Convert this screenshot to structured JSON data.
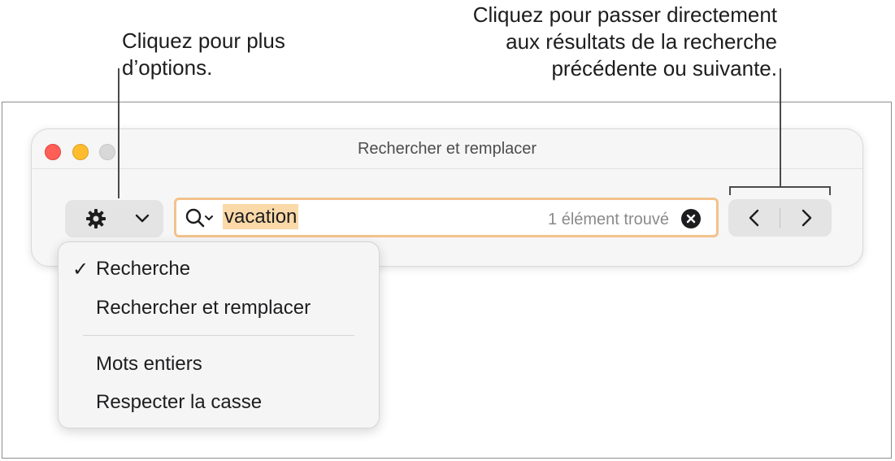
{
  "callouts": {
    "left": [
      "Cliquez pour plus",
      "d’options."
    ],
    "right": [
      "Cliquez pour passer directement",
      "aux résultats de la recherche",
      "précédente ou suivante."
    ]
  },
  "window": {
    "title": "Rechercher et remplacer"
  },
  "toolbar": {
    "options_icon": "gear-icon",
    "options_chevron_icon": "chevron-down-icon"
  },
  "search": {
    "icon": "magnifying-glass-with-chevron-icon",
    "value": "vacation",
    "result_count": "1 élément trouvé",
    "clear_icon": "clear-circle-icon",
    "focus_ring_color": "#f3c28c",
    "highlight_color": "#fbd9a8"
  },
  "navigation": {
    "prev_icon": "chevron-left-icon",
    "next_icon": "chevron-right-icon"
  },
  "options_menu": {
    "items": [
      {
        "label": "Recherche",
        "checked": true,
        "check_mark": "✓"
      },
      {
        "label": "Rechercher et remplacer",
        "checked": false
      }
    ],
    "items_after_separator": [
      {
        "label": "Mots entiers",
        "checked": false
      },
      {
        "label": "Respecter la casse",
        "checked": false
      }
    ]
  },
  "colors": {
    "close": "#ff5f57",
    "minimize": "#febc2e",
    "zoom_disabled": "#d8d8d8"
  }
}
